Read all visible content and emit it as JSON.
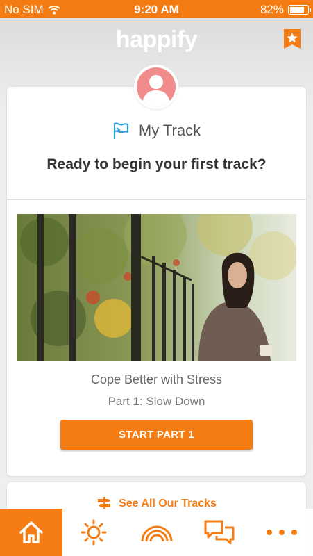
{
  "status": {
    "carrier": "No SIM",
    "time": "9:20 AM",
    "battery": "82%",
    "battery_level": 0.82
  },
  "app": {
    "logo": "happify"
  },
  "track": {
    "title": "My Track",
    "question": "Ready to begin your first track?",
    "course_name": "Cope Better with Stress",
    "part": "Part 1: Slow Down",
    "start_label": "START PART 1"
  },
  "tracks_link": {
    "label": "See All Our Tracks"
  },
  "tabs": [
    {
      "icon": "home-icon",
      "active": true
    },
    {
      "icon": "sun-icon",
      "active": false
    },
    {
      "icon": "rainbow-icon",
      "active": false
    },
    {
      "icon": "chat-icon",
      "active": false
    },
    {
      "icon": "more-icon",
      "active": false
    }
  ],
  "colors": {
    "accent": "#f57c12",
    "flag": "#2a9fd8",
    "avatar": "#f08c8c"
  }
}
